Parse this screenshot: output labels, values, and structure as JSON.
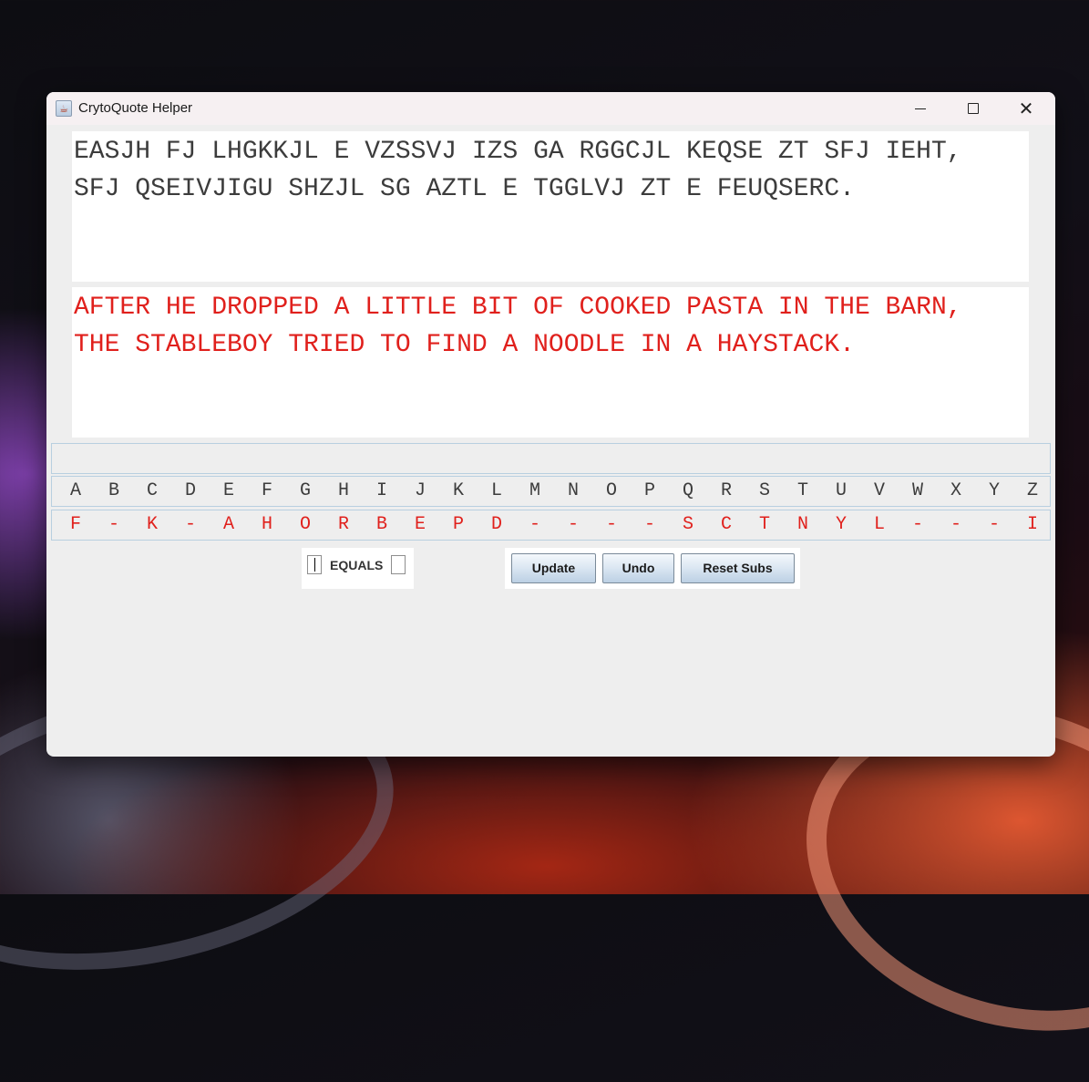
{
  "window": {
    "title": "CrytoQuote Helper",
    "icon": "java-cup-icon",
    "controls": {
      "minimize": "minimize-icon",
      "maximize": "maximize-icon",
      "close": "close-icon"
    }
  },
  "cipher_text": "EASJH FJ LHGKKJL E VZSSVJ IZS GA RGGCJL KEQSE ZT SFJ IEHT,\nSFJ QSEIVJIGU SHZJL SG AZTL E TGGLVJ ZT E FEUQSERC.",
  "plain_text": "AFTER HE DROPPED A LITTLE BIT OF COOKED PASTA IN THE BARN,\nTHE STABLEBOY TRIED TO FIND A NOODLE IN A HAYSTACK.",
  "input_strip": {
    "value": ""
  },
  "alphabet": [
    "A",
    "B",
    "C",
    "D",
    "E",
    "F",
    "G",
    "H",
    "I",
    "J",
    "K",
    "L",
    "M",
    "N",
    "O",
    "P",
    "Q",
    "R",
    "S",
    "T",
    "U",
    "V",
    "W",
    "X",
    "Y",
    "Z"
  ],
  "substitutions": [
    "F",
    "-",
    "K",
    "-",
    "A",
    "H",
    "O",
    "R",
    "B",
    "E",
    "P",
    "D",
    "-",
    "-",
    "-",
    "-",
    "S",
    "C",
    "T",
    "N",
    "Y",
    "L",
    "-",
    "-",
    "-",
    "I"
  ],
  "equals": {
    "label": "EQUALS",
    "left_value": "",
    "right_value": ""
  },
  "buttons": {
    "update": "Update",
    "undo": "Undo",
    "reset": "Reset Subs"
  },
  "colors": {
    "cipher": "#3c3c3c",
    "plain": "#e0201c",
    "background": "#eeeeee"
  }
}
